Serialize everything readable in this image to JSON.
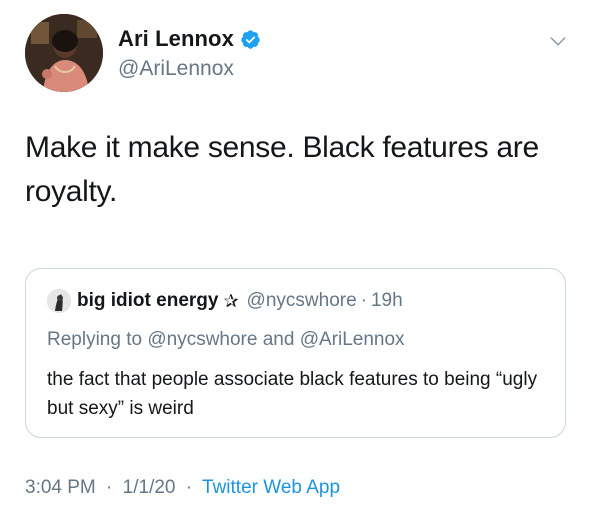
{
  "author": {
    "display_name": "Ari Lennox",
    "handle": "@AriLennox",
    "verified_icon": "verified-badge-icon",
    "menu_icon": "chevron-down-icon"
  },
  "tweet": {
    "text": "Make it make sense. Black features are royalty."
  },
  "quoted_tweet": {
    "display_name": "big idiot energy",
    "emoji": "✰",
    "handle": "@nycswhore",
    "dot": "·",
    "time": "19h",
    "replying_prefix": "Replying to",
    "replying_user_1": "@nycswhore",
    "replying_and": "and",
    "replying_user_2": "@AriLennox",
    "text": "the fact that people associate black features to being “ugly but sexy” is weird"
  },
  "meta": {
    "time": "3:04 PM",
    "sep1": "·",
    "date": "1/1/20",
    "sep2": "·",
    "source": "Twitter Web App"
  },
  "colors": {
    "primary_text": "#14171a",
    "secondary_text": "#657786",
    "link": "#1b95e0",
    "verified": "#1da1f2",
    "border": "#ccd6dd"
  }
}
